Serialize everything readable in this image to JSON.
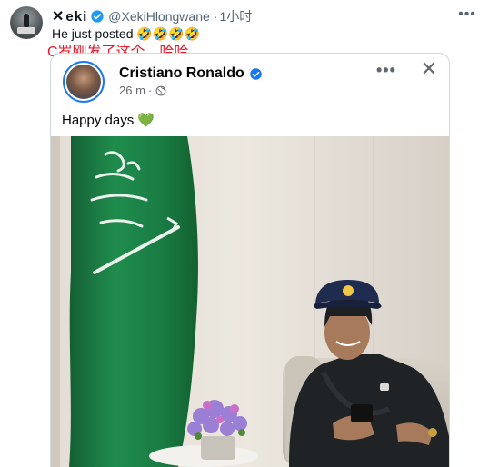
{
  "tweet": {
    "display_name": "eki",
    "x_mark": "✕",
    "handle": "@XekiHlongwane",
    "time": "1小时",
    "dot": "·",
    "text": "He just posted 🤣🤣🤣🤣",
    "annotation": "C罗刚发了这个，哈哈",
    "more_icon": "more-horizontal-icon"
  },
  "embedded_post": {
    "author": "Cristiano Ronaldo",
    "time_ago": "26 m",
    "dot": "·",
    "text": "Happy days 💚",
    "privacy_icon": "globe-icon",
    "more_label": "•••",
    "close_label": "✕"
  },
  "colors": {
    "x_blue": "#1d9bf0",
    "fb_blue": "#1877f2",
    "annotation_red": "#e8192c",
    "flag_green": "#1a7d44"
  }
}
